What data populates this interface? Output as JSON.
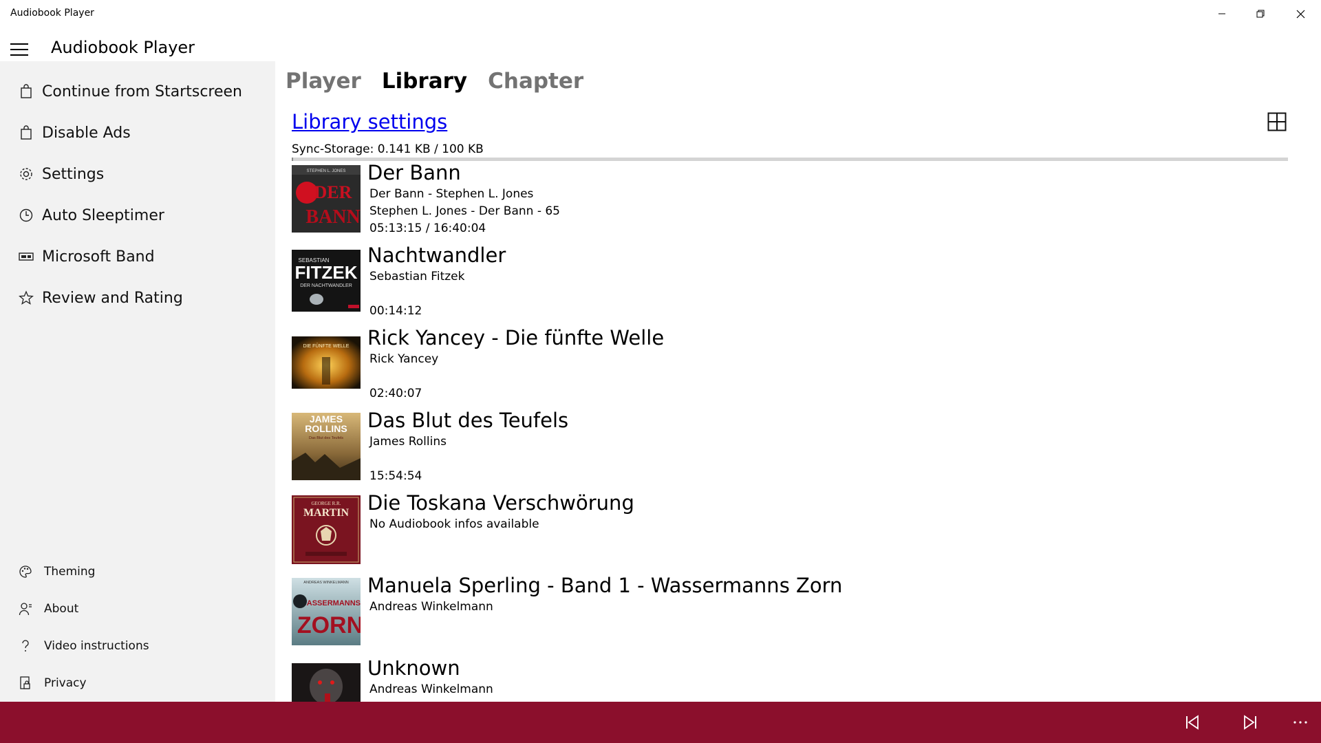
{
  "window": {
    "title": "Audiobook Player"
  },
  "header": {
    "title": "Audiobook Player"
  },
  "sidebar": {
    "items": [
      {
        "label": "Continue from Startscreen",
        "icon": "store-bag-icon"
      },
      {
        "label": "Disable Ads",
        "icon": "store-bag-icon"
      },
      {
        "label": "Settings",
        "icon": "gear-icon"
      },
      {
        "label": "Auto Sleeptimer",
        "icon": "clock-icon"
      },
      {
        "label": "Microsoft Band",
        "icon": "band-icon"
      },
      {
        "label": "Review and Rating",
        "icon": "star-icon"
      }
    ],
    "footer_items": [
      {
        "label": "Theming",
        "icon": "palette-icon"
      },
      {
        "label": "About",
        "icon": "person-icon"
      },
      {
        "label": "Video instructions",
        "icon": "question-icon"
      },
      {
        "label": "Privacy",
        "icon": "lock-document-icon"
      }
    ]
  },
  "tabs": [
    {
      "label": "Player",
      "active": false
    },
    {
      "label": "Library",
      "active": true
    },
    {
      "label": "Chapter",
      "active": false
    }
  ],
  "library": {
    "settings_link": "Library settings",
    "sync_storage": "Sync-Storage: 0.141 KB / 100 KB",
    "sync_fraction": 0.00141,
    "books": [
      {
        "title": "Der Bann",
        "line1": "Der Bann - Stephen L. Jones",
        "line2": "Stephen L. Jones - Der Bann - 65",
        "line3": "05:13:15 / 16:40:04"
      },
      {
        "title": "Nachtwandler",
        "line1": "Sebastian Fitzek",
        "line2": "",
        "line3": "00:14:12"
      },
      {
        "title": "Rick Yancey - Die fünfte Welle",
        "line1": "Rick Yancey",
        "line2": "",
        "line3": "02:40:07"
      },
      {
        "title": "Das Blut des Teufels",
        "line1": "James Rollins",
        "line2": "",
        "line3": "15:54:54"
      },
      {
        "title": "Die Toskana Verschwörung",
        "line1": "No Audiobook infos available",
        "line2": "",
        "line3": ""
      },
      {
        "title": "Manuela Sperling - Band 1 - Wassermanns Zorn",
        "line1": "Andreas Winkelmann",
        "line2": "",
        "line3": ""
      },
      {
        "title": "Unknown",
        "line1": "Andreas Winkelmann",
        "line2": "",
        "line3": ""
      }
    ],
    "covers": [
      {
        "text_top": "STEPHEN L. JONES",
        "text_main": "DER BANN"
      },
      {
        "text_top": "SEBASTIAN",
        "text_main": "FITZEK",
        "text_sub": "DER NACHTWANDLER"
      },
      {
        "text_main": "DIE FÜNFTE WELLE"
      },
      {
        "text_top": "JAMES",
        "text_main": "ROLLINS",
        "text_sub": "Das Blut des Teufels"
      },
      {
        "text_top": "GEORGE R.R.",
        "text_main": "MARTIN"
      },
      {
        "text_top": "ANDREAS WINKELMANN",
        "text_main": "WASSERMANNS ZORN"
      },
      {
        "text_main": ""
      }
    ]
  },
  "colors": {
    "accent": "#8b0f2c",
    "sidebar_bg": "#f2f2f2",
    "link": "#0000ee"
  },
  "bottombar": {
    "buttons": [
      "previous-icon",
      "next-icon",
      "more-icon"
    ]
  }
}
